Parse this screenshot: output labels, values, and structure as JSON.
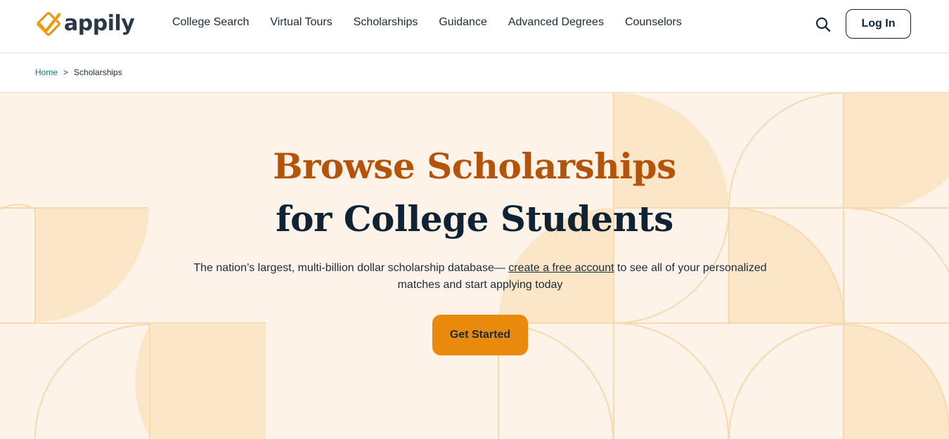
{
  "brand": {
    "name": "appily",
    "logo_icon": "checkmark-diamond-icon",
    "accent": "#e8900f"
  },
  "nav": {
    "items": [
      {
        "label": "College Search"
      },
      {
        "label": "Virtual Tours"
      },
      {
        "label": "Scholarships"
      },
      {
        "label": "Guidance"
      },
      {
        "label": "Advanced Degrees"
      },
      {
        "label": "Counselors"
      }
    ],
    "search_icon": "search-icon",
    "login_label": "Log In"
  },
  "breadcrumb": {
    "home": "Home",
    "separator": ">",
    "current": "Scholarships"
  },
  "hero": {
    "title_line1": "Browse Scholarships",
    "title_line2": "for College Students",
    "subtitle_before": "The nation’s largest, multi-billion dollar scholarship database— ",
    "subtitle_link": "create a free account",
    "subtitle_after": " to see all of your personalized matches and start applying today",
    "cta_label": "Get Started"
  },
  "colors": {
    "hero_background": "#fdf3e8",
    "title_orange": "#b4530a",
    "title_navy": "#0f2335",
    "cta_orange": "#ea8a0d",
    "link_teal": "#137a70",
    "pattern_fill": "#fbe6c8",
    "pattern_line": "#f8d9ae"
  }
}
